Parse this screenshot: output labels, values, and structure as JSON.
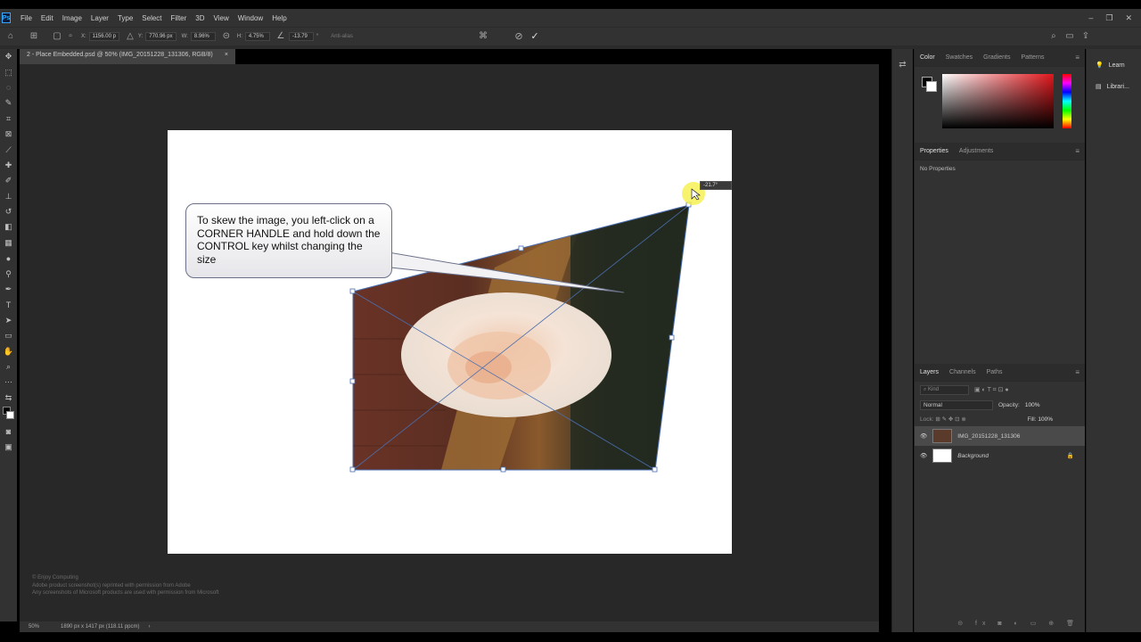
{
  "menu": {
    "logo": "Ps",
    "items": [
      "File",
      "Edit",
      "Image",
      "Layer",
      "Type",
      "Select",
      "Filter",
      "3D",
      "View",
      "Window",
      "Help"
    ]
  },
  "window_controls": {
    "minimize": "–",
    "restore": "❐",
    "close": "✕"
  },
  "options_bar": {
    "x_label": "X:",
    "x_value": "1156.00 p",
    "y_label": "Y:",
    "y_value": "770.96 px",
    "w_label": "W:",
    "w_value": "8.96%",
    "h_label": "H:",
    "h_value": "4.75%",
    "angle_value": "-13.79",
    "angle_unit": "°",
    "antialias": "Anti-alias",
    "cancel_icon": "cancel-icon",
    "commit_icon": "commit-check-icon"
  },
  "document": {
    "tab_title": "2 - Place Embedded.psd @ 50% (IMG_20151228_131306, RGB/8)",
    "tab_close": "×",
    "angle_readout": "-21.7°"
  },
  "callout": {
    "text": "To skew the image, you left-click on a CORNER HANDLE and hold down the CONTROL key whilst changing the size"
  },
  "copyright": {
    "line1": "© Enjoy Computing",
    "line2": "Adobe product screenshot(s) reprinted with permission from Adobe",
    "line3": "Any screenshots of Microsoft products are used with permission from Microsoft"
  },
  "status": {
    "zoom": "50%",
    "doc_size": "1890 px x 1417 px (118.11 ppcm)",
    "arrow": "›"
  },
  "color_panel": {
    "tabs": [
      "Color",
      "Swatches",
      "Gradients",
      "Patterns"
    ],
    "active_tab": "Color",
    "hue_color": "#e0161b"
  },
  "properties_panel": {
    "tabs": [
      "Properties",
      "Adjustments"
    ],
    "empty_text": "No Properties"
  },
  "layers_panel": {
    "tabs": [
      "Layers",
      "Channels",
      "Paths"
    ],
    "search_placeholder": "Kind",
    "blend_mode": "Normal",
    "opacity_label": "Opacity:",
    "opacity_value": "100%",
    "lock_label": "Lock:",
    "fill_label": "Fill:",
    "fill_value": "100%",
    "layers": [
      {
        "name": "IMG_20151228_131306",
        "selected": true
      },
      {
        "name": "Background",
        "selected": false,
        "locked": true
      }
    ]
  },
  "far_panel": {
    "learn": "Learn",
    "libraries": "Librari..."
  }
}
